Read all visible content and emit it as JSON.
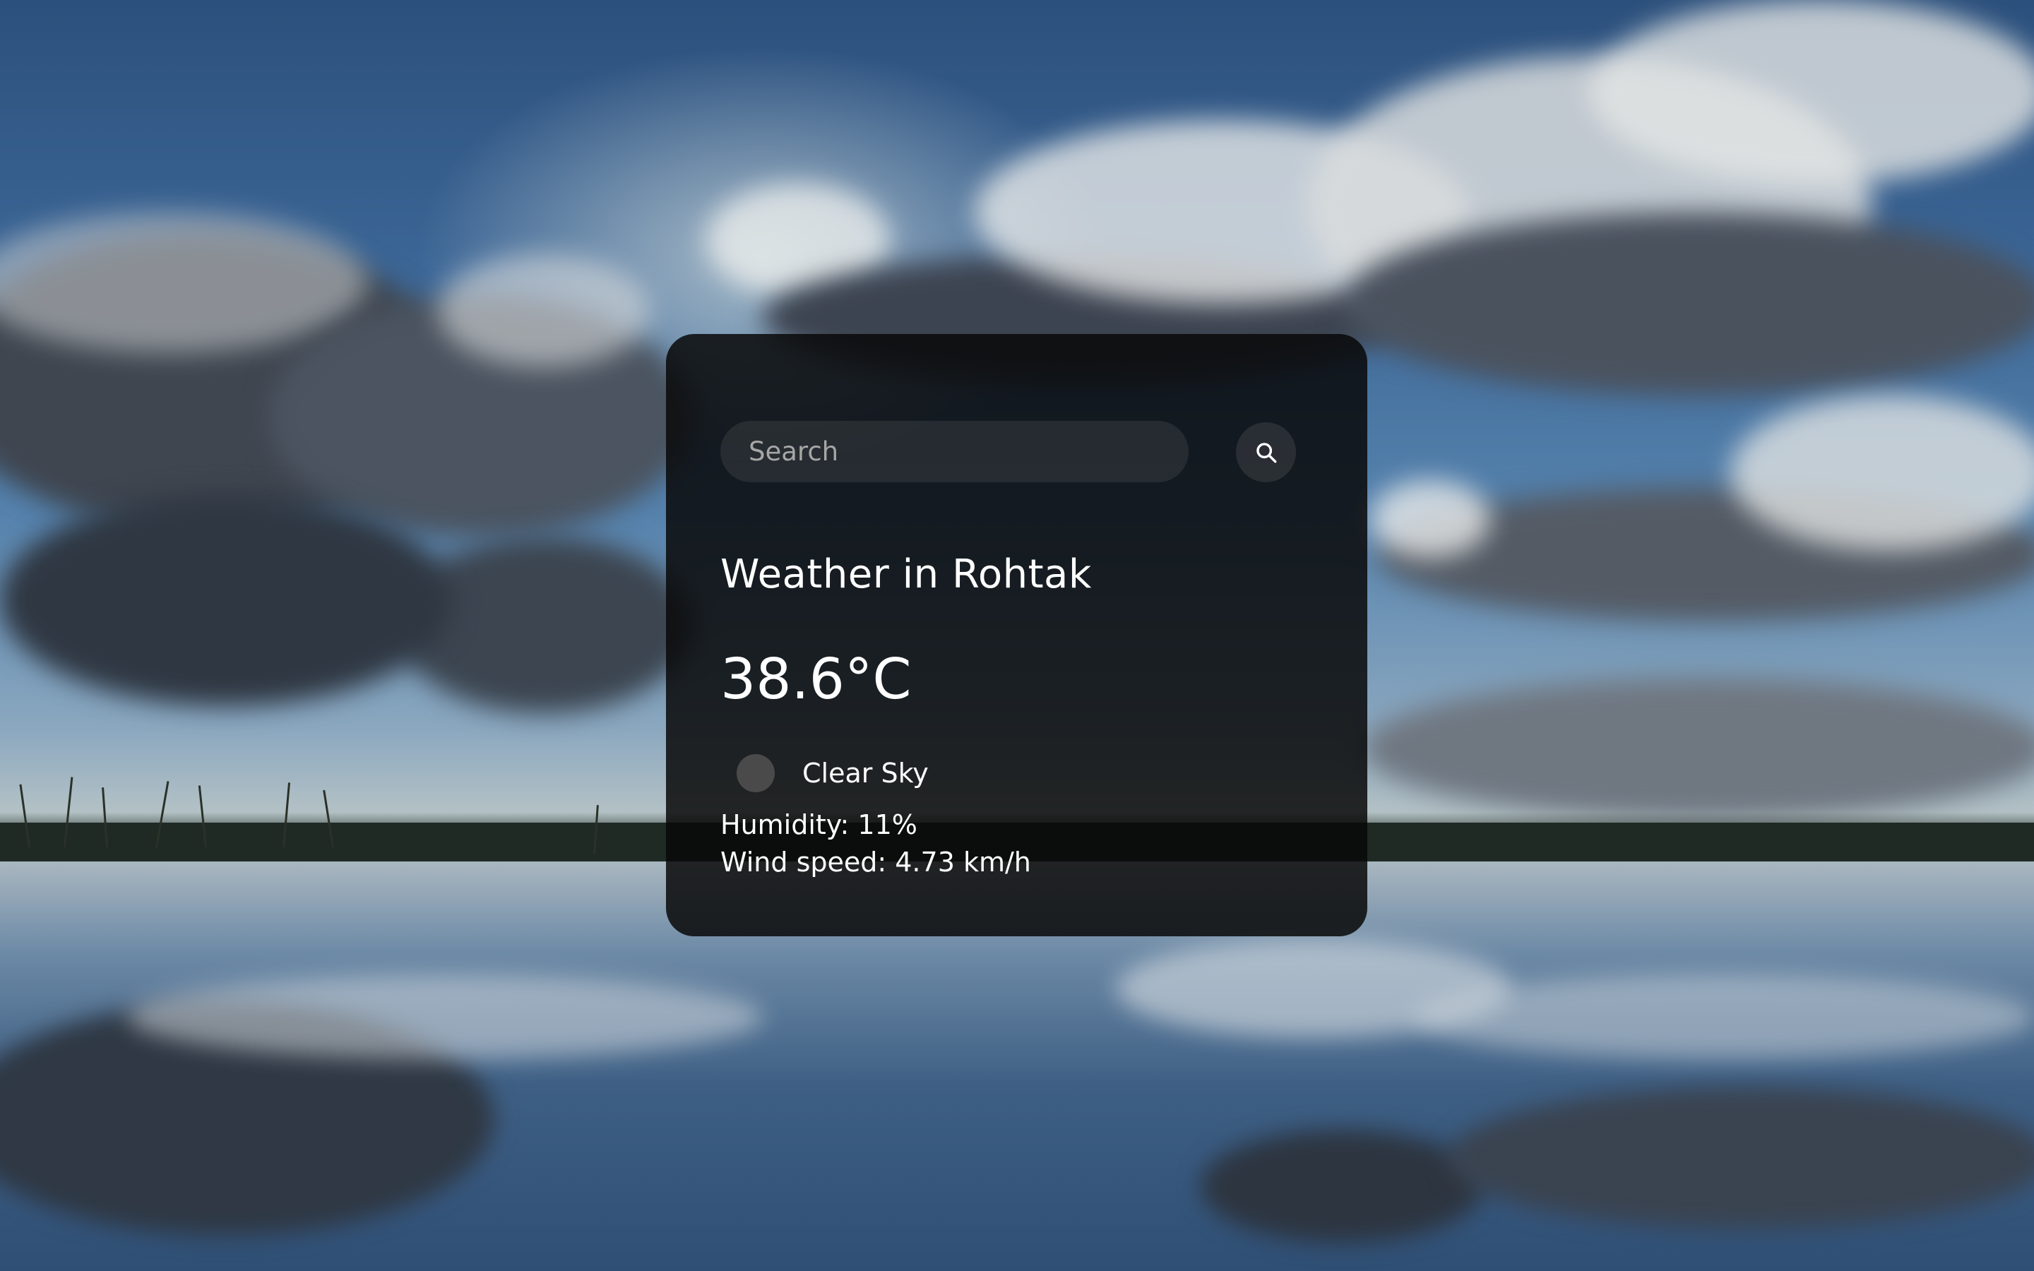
{
  "search": {
    "placeholder": "Search",
    "value": ""
  },
  "weather": {
    "title": "Weather in Rohtak",
    "temperature": "38.6°C",
    "condition": "Clear Sky",
    "humidity": "Humidity: 11%",
    "wind_speed": "Wind speed: 4.73 km/h"
  },
  "icons": {
    "search_button": "search-icon",
    "condition": "weather-condition-icon"
  },
  "colors": {
    "card_background": "#0b0b0bd9",
    "text": "#ffffff",
    "placeholder": "#a6a6a6",
    "input_background": "#3a3a3a",
    "condition_icon": "#4a4a4a"
  }
}
